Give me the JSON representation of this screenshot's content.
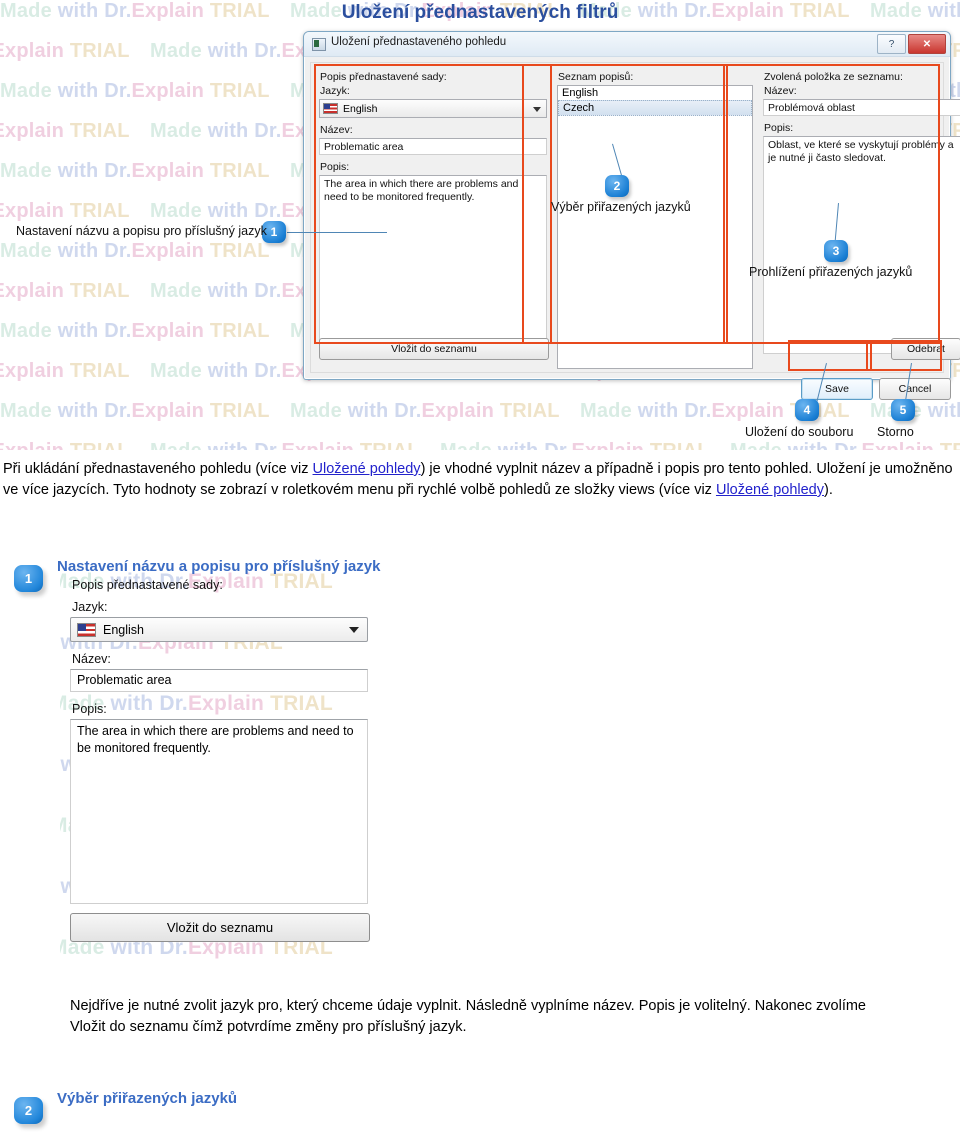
{
  "page": {
    "title": "Uložení přednastavených filtrů"
  },
  "watermark": {
    "parts": [
      "Made ",
      "with ",
      "Dr.",
      "Explain ",
      "TRIAL"
    ]
  },
  "dialog": {
    "titlebar": {
      "title": "Uložení přednastaveného pohledu",
      "help_button": "?",
      "close_button": "✕",
      "icon": "window-icon"
    },
    "left_panel": {
      "group_label": "Popis přednastavené sady:",
      "language_label": "Jazyk:",
      "language_value": "English",
      "name_label": "Název:",
      "name_value": "Problematic area",
      "description_label": "Popis:",
      "description_value": "The area in which there are problems and need to be monitored frequently.",
      "add_button": "Vložit do seznamu"
    },
    "middle_panel": {
      "list_label": "Seznam popisů:",
      "items": [
        {
          "label": "English",
          "selected": false
        },
        {
          "label": "Czech",
          "selected": true
        }
      ]
    },
    "right_panel": {
      "group_label": "Zvolená položka ze seznamu:",
      "name_label": "Název:",
      "name_value": "Problémová oblast",
      "description_label": "Popis:",
      "description_value": "Oblast, ve které se vyskytují problémy a je nutné ji často sledovat.",
      "remove_button": "Odebrat"
    },
    "footer": {
      "save_button": "Save",
      "cancel_button": "Cancel"
    }
  },
  "callouts": [
    {
      "num": "1",
      "text": "Nastavení názvu a popisu pro příslušný jazyk"
    },
    {
      "num": "2",
      "text": "Výběr přiřazených jazyků"
    },
    {
      "num": "3",
      "text": "Prohlížení přiřazených jazyků"
    },
    {
      "num": "4",
      "text": "Uložení do souboru"
    },
    {
      "num": "5",
      "text": "Storno"
    }
  ],
  "intro": {
    "p1_a": "Při ukládání přednastaveného pohledu (více viz ",
    "p1_link1": "Uložené pohledy",
    "p1_b": ") je vhodné vyplnit název a případně i popis pro tento pohled. Uložení je umožněno ve více jazycích. Tyto hodnoty se zobrazí v roletkovém menu při rychlé volbě pohledů ze složky views (více viz ",
    "p1_link2": "Uložené pohledy",
    "p1_c": ")."
  },
  "section1": {
    "num": "1",
    "heading": "Nastavení názvu a popisu pro příslušný jazyk",
    "shot": {
      "group_label": "Popis přednastavené sady:",
      "language_label": "Jazyk:",
      "language_value": "English",
      "name_label": "Název:",
      "name_value": "Problematic area",
      "description_label": "Popis:",
      "description_value": "The area in which there are problems and need to be monitored frequently.",
      "add_button": "Vložit do seznamu"
    },
    "paragraph": "Nejdříve je nutné zvolit jazyk pro, který chceme údaje vyplnit. Následně vyplníme název. Popis je volitelný. Nakonec zvolíme Vložit do seznamu čímž potvrdíme změny pro příslušný jazyk."
  },
  "section2": {
    "num": "2",
    "heading": "Výběr přiřazených jazyků"
  }
}
